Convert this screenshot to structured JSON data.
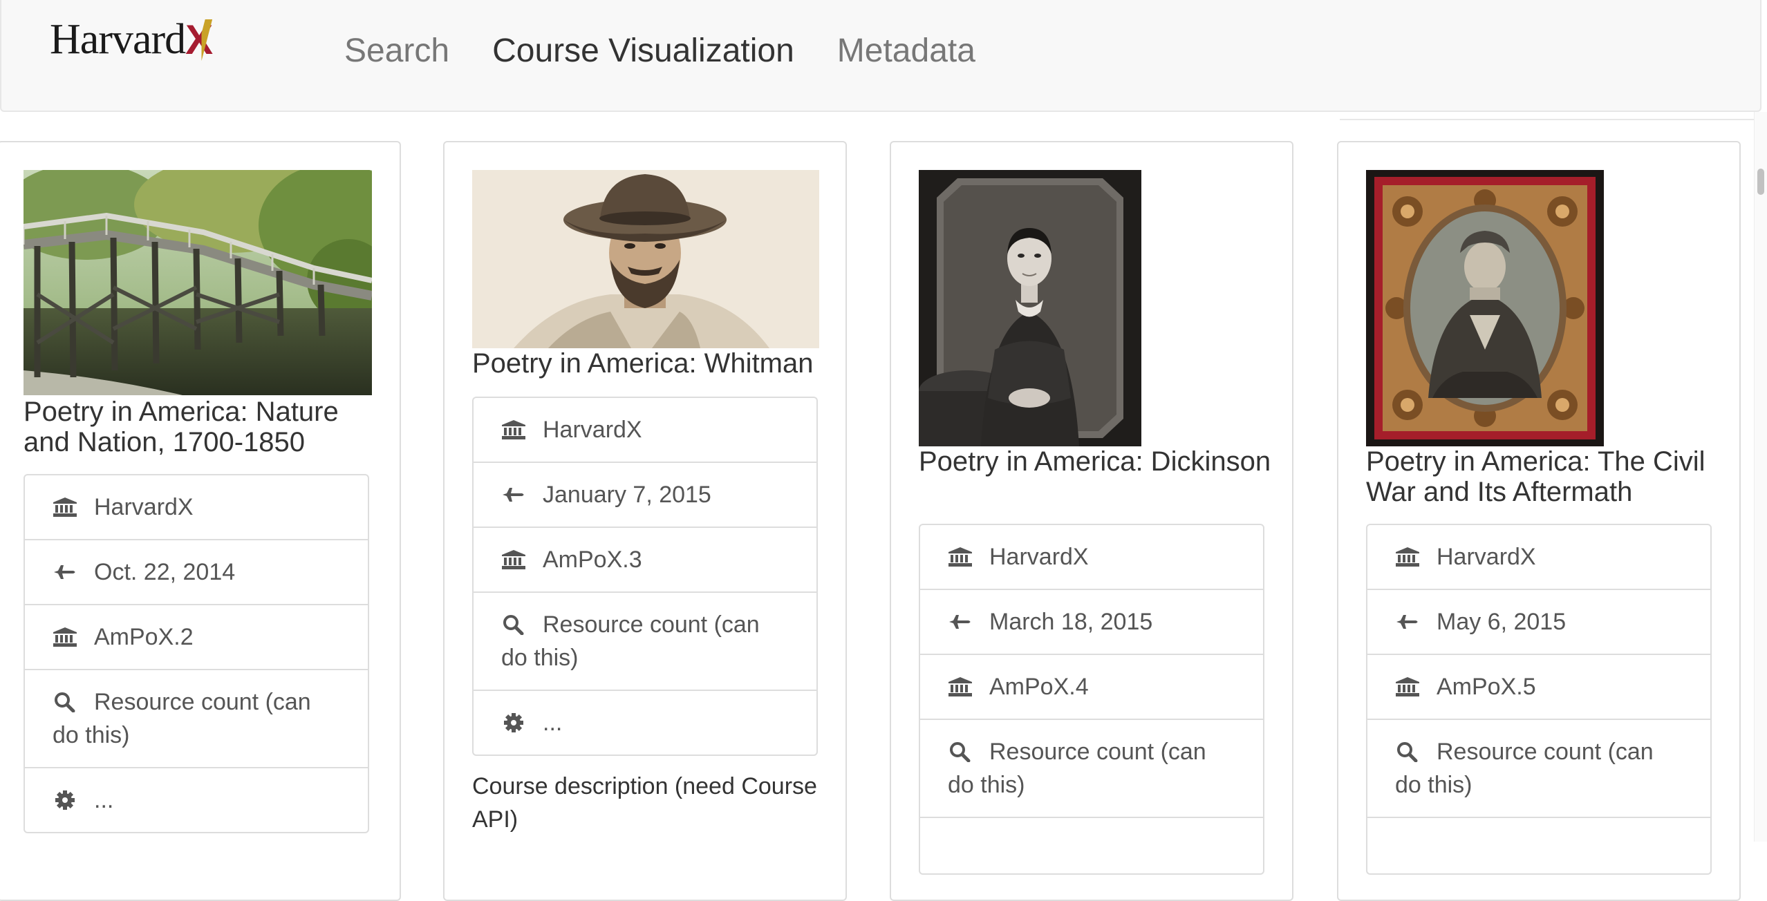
{
  "nav": {
    "brand": "Harvard",
    "brand_x": "X",
    "links": [
      "Search",
      "Course Visualization",
      "Metadata"
    ],
    "active": "Course Visualization"
  },
  "cards": [
    {
      "title": "Poetry in America: Nature and Nation, 1700-1850",
      "org": "HarvardX",
      "date": "Oct. 22, 2014",
      "course": "AmPoX.2",
      "resource": "Resource count (can do this)",
      "more": "..."
    },
    {
      "title": "Poetry in America: Whitman",
      "org": "HarvardX",
      "date": "January 7, 2015",
      "course": "AmPoX.3",
      "resource": "Resource count (can do this)",
      "more": "...",
      "description": "Course description (need Course API)"
    },
    {
      "title": "Poetry in America: Dickinson",
      "org": "HarvardX",
      "date": "March 18, 2015",
      "course": "AmPoX.4",
      "resource": "Resource count (can do this)"
    },
    {
      "title": "Poetry in America: The Civil War and Its Aftermath",
      "org": "HarvardX",
      "date": "May 6, 2015",
      "course": "AmPoX.5",
      "resource": "Resource count (can do this)"
    }
  ],
  "icons": {
    "org": "institution-icon",
    "date": "plane-icon",
    "course": "institution-icon",
    "resource": "search-icon",
    "more": "gear-icon"
  }
}
